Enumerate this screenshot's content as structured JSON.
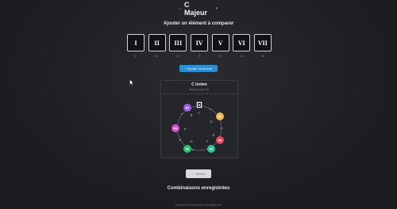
{
  "key_selector": {
    "label": "C Majeur",
    "arrow": "←",
    "caret": "▾"
  },
  "compare": {
    "title": "Ajouter un élément à comparer",
    "degrees": [
      {
        "numeral": "I",
        "note": "C"
      },
      {
        "numeral": "II",
        "note": "D"
      },
      {
        "numeral": "III",
        "note": "E"
      },
      {
        "numeral": "IV",
        "note": "F"
      },
      {
        "numeral": "V",
        "note": "G"
      },
      {
        "numeral": "VI",
        "note": "A"
      },
      {
        "numeral": "VII",
        "note": "B"
      }
    ],
    "add_chord_label": "+ Ajouter un accord"
  },
  "mode_card": {
    "title": "C Ionien",
    "subtitle": "Majeur (mode n°1)",
    "root_marker": "R",
    "intervals": [
      {
        "label": "M2",
        "color": "#f2b84b"
      },
      {
        "label": "M3",
        "color": "#e8485a"
      },
      {
        "label": "P4",
        "color": "#2fbf9b"
      },
      {
        "label": "P5",
        "color": "#2fbf71"
      },
      {
        "label": "M6",
        "color": "#d94fd1"
      },
      {
        "label": "M7",
        "color": "#9b5de5"
      }
    ],
    "notes": [
      "C",
      "D",
      "E",
      "F",
      "G",
      "A",
      "B"
    ]
  },
  "return_label": "← Retour",
  "saved": {
    "title": "Combinaisons enregistrées",
    "empty_text": "Aucune combinaison enregistrée"
  }
}
